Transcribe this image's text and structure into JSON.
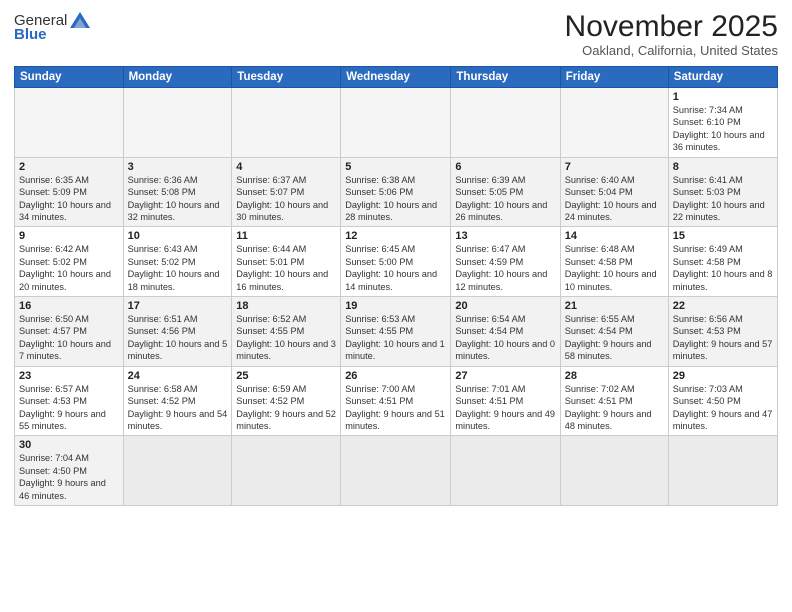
{
  "header": {
    "logo_line1": "General",
    "logo_line2": "Blue",
    "month": "November 2025",
    "location": "Oakland, California, United States"
  },
  "days_of_week": [
    "Sunday",
    "Monday",
    "Tuesday",
    "Wednesday",
    "Thursday",
    "Friday",
    "Saturday"
  ],
  "weeks": [
    [
      {
        "num": "",
        "info": ""
      },
      {
        "num": "",
        "info": ""
      },
      {
        "num": "",
        "info": ""
      },
      {
        "num": "",
        "info": ""
      },
      {
        "num": "",
        "info": ""
      },
      {
        "num": "",
        "info": ""
      },
      {
        "num": "1",
        "info": "Sunrise: 7:34 AM\nSunset: 6:10 PM\nDaylight: 10 hours and 36 minutes."
      }
    ],
    [
      {
        "num": "2",
        "info": "Sunrise: 6:35 AM\nSunset: 5:09 PM\nDaylight: 10 hours and 34 minutes."
      },
      {
        "num": "3",
        "info": "Sunrise: 6:36 AM\nSunset: 5:08 PM\nDaylight: 10 hours and 32 minutes."
      },
      {
        "num": "4",
        "info": "Sunrise: 6:37 AM\nSunset: 5:07 PM\nDaylight: 10 hours and 30 minutes."
      },
      {
        "num": "5",
        "info": "Sunrise: 6:38 AM\nSunset: 5:06 PM\nDaylight: 10 hours and 28 minutes."
      },
      {
        "num": "6",
        "info": "Sunrise: 6:39 AM\nSunset: 5:05 PM\nDaylight: 10 hours and 26 minutes."
      },
      {
        "num": "7",
        "info": "Sunrise: 6:40 AM\nSunset: 5:04 PM\nDaylight: 10 hours and 24 minutes."
      },
      {
        "num": "8",
        "info": "Sunrise: 6:41 AM\nSunset: 5:03 PM\nDaylight: 10 hours and 22 minutes."
      }
    ],
    [
      {
        "num": "9",
        "info": "Sunrise: 6:42 AM\nSunset: 5:02 PM\nDaylight: 10 hours and 20 minutes."
      },
      {
        "num": "10",
        "info": "Sunrise: 6:43 AM\nSunset: 5:02 PM\nDaylight: 10 hours and 18 minutes."
      },
      {
        "num": "11",
        "info": "Sunrise: 6:44 AM\nSunset: 5:01 PM\nDaylight: 10 hours and 16 minutes."
      },
      {
        "num": "12",
        "info": "Sunrise: 6:45 AM\nSunset: 5:00 PM\nDaylight: 10 hours and 14 minutes."
      },
      {
        "num": "13",
        "info": "Sunrise: 6:47 AM\nSunset: 4:59 PM\nDaylight: 10 hours and 12 minutes."
      },
      {
        "num": "14",
        "info": "Sunrise: 6:48 AM\nSunset: 4:58 PM\nDaylight: 10 hours and 10 minutes."
      },
      {
        "num": "15",
        "info": "Sunrise: 6:49 AM\nSunset: 4:58 PM\nDaylight: 10 hours and 8 minutes."
      }
    ],
    [
      {
        "num": "16",
        "info": "Sunrise: 6:50 AM\nSunset: 4:57 PM\nDaylight: 10 hours and 7 minutes."
      },
      {
        "num": "17",
        "info": "Sunrise: 6:51 AM\nSunset: 4:56 PM\nDaylight: 10 hours and 5 minutes."
      },
      {
        "num": "18",
        "info": "Sunrise: 6:52 AM\nSunset: 4:55 PM\nDaylight: 10 hours and 3 minutes."
      },
      {
        "num": "19",
        "info": "Sunrise: 6:53 AM\nSunset: 4:55 PM\nDaylight: 10 hours and 1 minute."
      },
      {
        "num": "20",
        "info": "Sunrise: 6:54 AM\nSunset: 4:54 PM\nDaylight: 10 hours and 0 minutes."
      },
      {
        "num": "21",
        "info": "Sunrise: 6:55 AM\nSunset: 4:54 PM\nDaylight: 9 hours and 58 minutes."
      },
      {
        "num": "22",
        "info": "Sunrise: 6:56 AM\nSunset: 4:53 PM\nDaylight: 9 hours and 57 minutes."
      }
    ],
    [
      {
        "num": "23",
        "info": "Sunrise: 6:57 AM\nSunset: 4:53 PM\nDaylight: 9 hours and 55 minutes."
      },
      {
        "num": "24",
        "info": "Sunrise: 6:58 AM\nSunset: 4:52 PM\nDaylight: 9 hours and 54 minutes."
      },
      {
        "num": "25",
        "info": "Sunrise: 6:59 AM\nSunset: 4:52 PM\nDaylight: 9 hours and 52 minutes."
      },
      {
        "num": "26",
        "info": "Sunrise: 7:00 AM\nSunset: 4:51 PM\nDaylight: 9 hours and 51 minutes."
      },
      {
        "num": "27",
        "info": "Sunrise: 7:01 AM\nSunset: 4:51 PM\nDaylight: 9 hours and 49 minutes."
      },
      {
        "num": "28",
        "info": "Sunrise: 7:02 AM\nSunset: 4:51 PM\nDaylight: 9 hours and 48 minutes."
      },
      {
        "num": "29",
        "info": "Sunrise: 7:03 AM\nSunset: 4:50 PM\nDaylight: 9 hours and 47 minutes."
      }
    ],
    [
      {
        "num": "30",
        "info": "Sunrise: 7:04 AM\nSunset: 4:50 PM\nDaylight: 9 hours and 46 minutes."
      },
      {
        "num": "",
        "info": ""
      },
      {
        "num": "",
        "info": ""
      },
      {
        "num": "",
        "info": ""
      },
      {
        "num": "",
        "info": ""
      },
      {
        "num": "",
        "info": ""
      },
      {
        "num": "",
        "info": ""
      }
    ]
  ]
}
